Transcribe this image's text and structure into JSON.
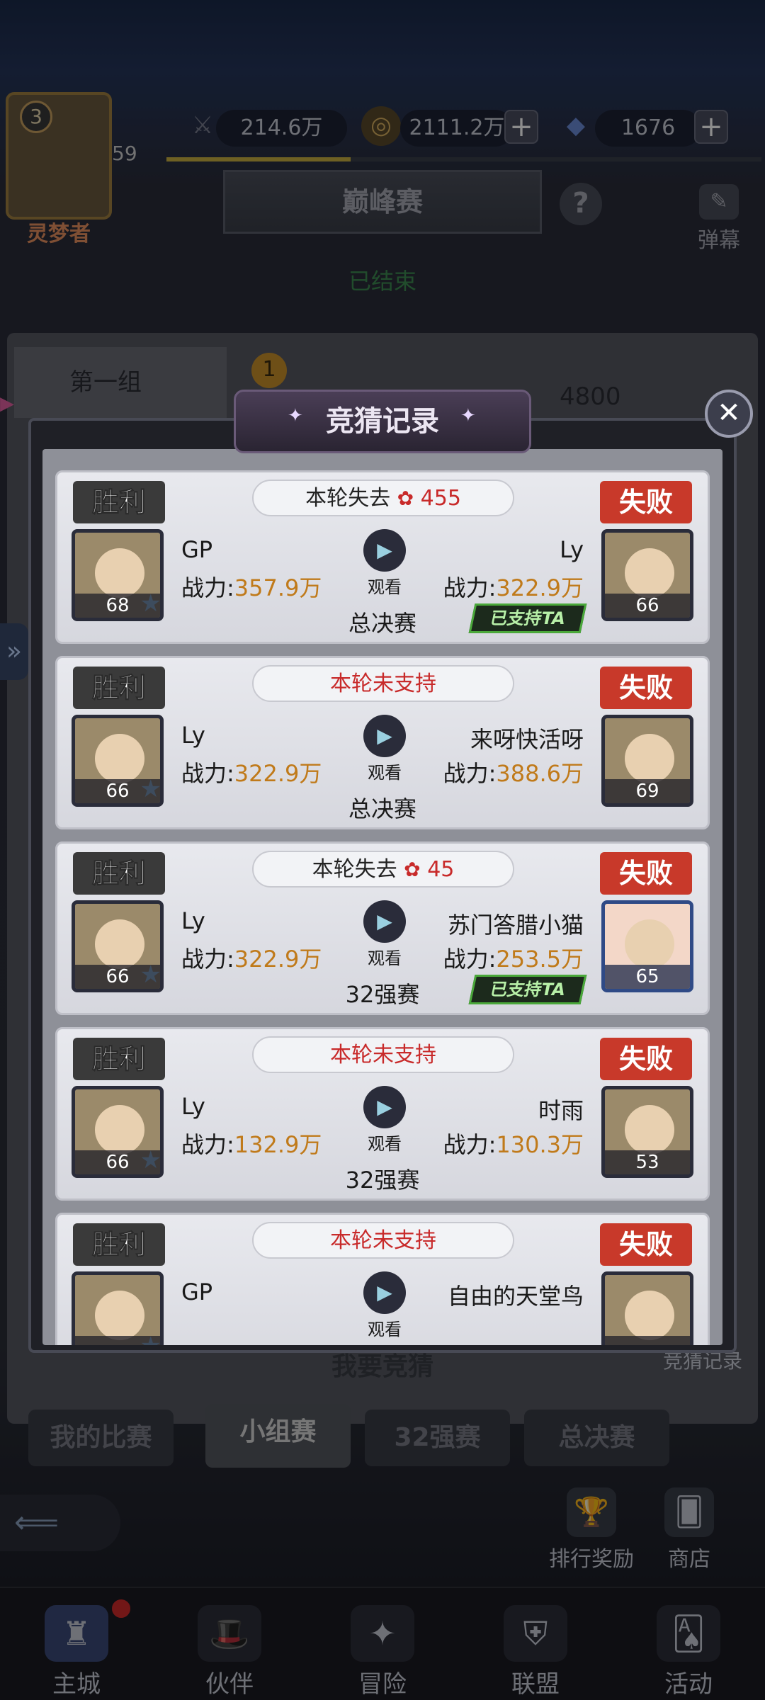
{
  "top_bar": {
    "player_level_badge": "3",
    "player_level": "59",
    "player_name": "灵梦者",
    "resources": [
      {
        "icon": "sword-icon",
        "value": "214.6万"
      },
      {
        "icon": "coin-icon",
        "value": "2111.2万"
      },
      {
        "icon": "diamond-icon",
        "value": "1676"
      }
    ],
    "exp_progress": 0.31
  },
  "header": {
    "title": "巅峰赛",
    "status": "已结束",
    "danmu_label": "弹幕"
  },
  "background": {
    "group_label": "第一组",
    "rank": "1",
    "score": "4800",
    "guess_button": "我要竞猜",
    "record_entry": "竞猜记录"
  },
  "tabs": [
    {
      "label": "我的比赛",
      "active": false
    },
    {
      "label": "小组赛",
      "active": true
    },
    {
      "label": "32强赛",
      "active": false
    },
    {
      "label": "总决赛",
      "active": false
    }
  ],
  "side_tools": [
    {
      "label": "排行奖励",
      "icon": "trophy-icon"
    },
    {
      "label": "商店",
      "icon": "cards-icon"
    }
  ],
  "bottom_nav": [
    {
      "label": "主城",
      "icon": "castle-icon",
      "active": true,
      "badge": true
    },
    {
      "label": "伙伴",
      "icon": "witch-hat-icon",
      "active": false
    },
    {
      "label": "冒险",
      "icon": "compass-icon",
      "active": false
    },
    {
      "label": "联盟",
      "icon": "shield-icon",
      "active": false
    },
    {
      "label": "活动",
      "icon": "cards-icon",
      "active": false
    }
  ],
  "modal": {
    "title": "竞猜记录",
    "records": [
      {
        "win_tag": "胜利",
        "lose_tag": "失败",
        "status_prefix": "本轮失去",
        "status_amount": "455",
        "status_kind": "lost",
        "left_name": "GP",
        "left_power": "357.9万",
        "left_level": "68",
        "right_name": "Ly",
        "right_power": "322.9万",
        "right_level": "66",
        "round": "总决赛",
        "supported_right": true
      },
      {
        "win_tag": "胜利",
        "lose_tag": "失败",
        "status_prefix": "本轮未支持",
        "status_amount": "",
        "status_kind": "none",
        "left_name": "Ly",
        "left_power": "322.9万",
        "left_level": "66",
        "right_name": "来呀快活呀",
        "right_power": "388.6万",
        "right_level": "69",
        "round": "总决赛",
        "supported_right": false
      },
      {
        "win_tag": "胜利",
        "lose_tag": "失败",
        "status_prefix": "本轮失去",
        "status_amount": "45",
        "status_kind": "lost",
        "left_name": "Ly",
        "left_power": "322.9万",
        "left_level": "66",
        "right_name": "苏门答腊小猫",
        "right_power": "253.5万",
        "right_level": "65",
        "round": "32强赛",
        "supported_right": true
      },
      {
        "win_tag": "胜利",
        "lose_tag": "失败",
        "status_prefix": "本轮未支持",
        "status_amount": "",
        "status_kind": "none",
        "left_name": "Ly",
        "left_power": "132.9万",
        "left_level": "66",
        "right_name": "时雨",
        "right_power": "130.3万",
        "right_level": "53",
        "round": "32强赛",
        "supported_right": false
      },
      {
        "win_tag": "胜利",
        "lose_tag": "失败",
        "status_prefix": "本轮未支持",
        "status_amount": "",
        "status_kind": "none",
        "left_name": "GP",
        "left_power": "",
        "left_level": "",
        "right_name": "自由的天堂鸟",
        "right_power": "",
        "right_level": "",
        "round": "",
        "supported_right": false
      }
    ],
    "power_label": "战力:",
    "watch_label": "观看",
    "supported_label": "已支持TA"
  },
  "colors": {
    "accent_gold": "#c07a1a",
    "loss_red": "#c82a2a",
    "support_green": "#4aa83a"
  }
}
